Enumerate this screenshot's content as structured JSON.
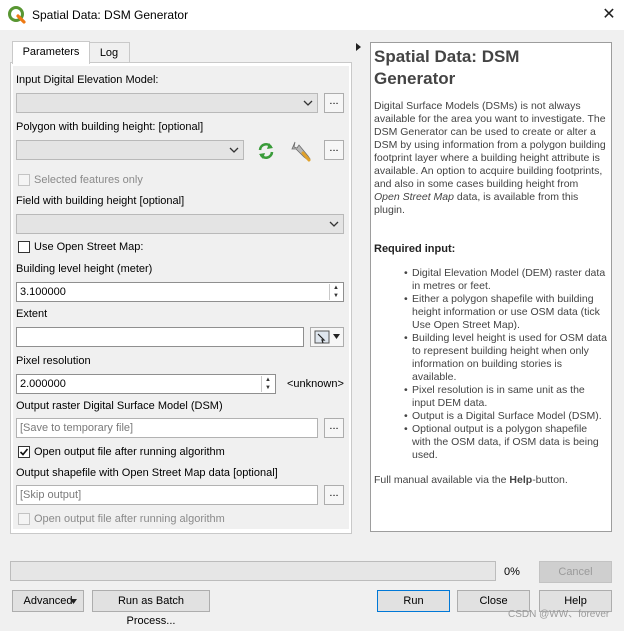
{
  "window": {
    "title": "Spatial Data: DSM Generator",
    "close_glyph": "✕"
  },
  "tabs": [
    {
      "label": "Parameters"
    },
    {
      "label": "Log"
    }
  ],
  "form": {
    "dem_label": "Input Digital Elevation Model:",
    "polygon_label": "Polygon with building height: [optional]",
    "selected_only_label": "Selected features only",
    "field_label": "Field with building height [optional]",
    "osm_label": "Use Open Street Map:",
    "level_height_label": "Building level height (meter)",
    "level_height_value": "3.100000",
    "extent_label": "Extent",
    "extent_value": "",
    "pixel_label": "Pixel resolution",
    "pixel_value": "2.000000",
    "pixel_unit": "<unknown>",
    "dsm_output_label": "Output raster Digital Surface Model (DSM)",
    "dsm_output_placeholder": "[Save to temporary file]",
    "open_after_label": "Open output file after running algorithm",
    "osm_output_label": "Output shapefile with Open Street Map data [optional]",
    "osm_output_placeholder": "[Skip output]",
    "open_after2_label": "Open output file after running algorithm",
    "dots": "..."
  },
  "help": {
    "title": "Spatial Data: DSM Generator",
    "desc_1": "Digital Surface Models (DSMs) is not always available for the area you want to investigate. The DSM Generator can be used to create or alter a DSM by using information from a polygon building footprint layer where a building height attribute is available. An option to acquire building footprints, and also in some cases building height from ",
    "desc_osm": "Open Street Map",
    "desc_2": " data, is available from this plugin.",
    "required_title": "Required input:",
    "items": [
      "Digital Elevation Model (DEM) raster data in metres or feet.",
      "Either a polygon shapefile with building height information or use OSM data (tick Use Open Street Map).",
      "Building level height is used for OSM data to represent building height when only information on building stories is available.",
      "Pixel resolution is in same unit as the input DEM data.",
      "Output is a Digital Surface Model (DSM).",
      "Optional output is a polygon shapefile with the OSM data, if OSM data is being used."
    ],
    "footer_pre": "Full manual available via the ",
    "footer_bold": "Help",
    "footer_post": "-button."
  },
  "progress": {
    "value": 0,
    "text": "0%"
  },
  "buttons": {
    "cancel": "Cancel",
    "advanced": "Advanced",
    "batch": "Run as Batch Process...",
    "run": "Run",
    "close": "Close",
    "help": "Help"
  },
  "watermark": "CSDN @WW、forever",
  "colors": {
    "qgis_green": "#589632",
    "qgis_yellow": "#ee7913",
    "refresh_green": "#3a9c3a",
    "focus_blue": "#0078d7"
  },
  "icons": [
    "qgis-logo-icon",
    "close-icon",
    "chevron-down-icon",
    "refresh-icon",
    "wrench-icon",
    "map-canvas-icon",
    "spin-up-icon",
    "spin-down-icon",
    "expand-triangle-icon"
  ]
}
